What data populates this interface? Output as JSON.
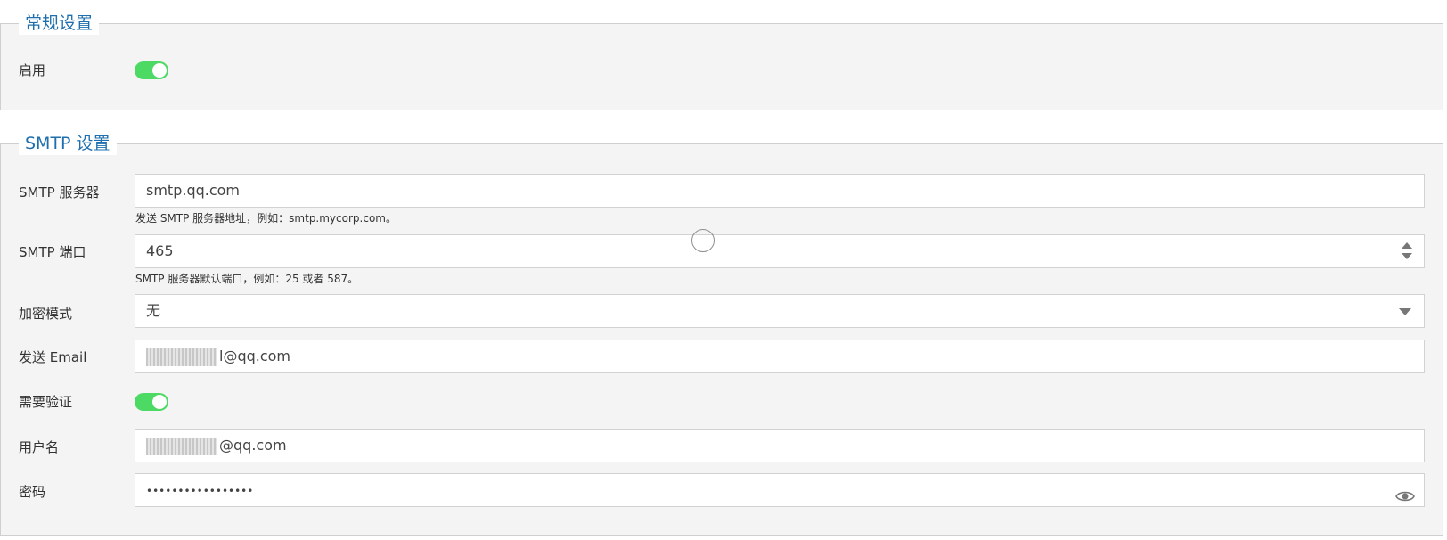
{
  "general": {
    "legend": "常规设置",
    "enabled_label": "启用",
    "enabled": true
  },
  "smtp": {
    "legend": "SMTP 设置",
    "server_label": "SMTP 服务器",
    "server_value": "smtp.qq.com",
    "server_hint": "发送 SMTP 服务器地址，例如：smtp.mycorp.com。",
    "port_label": "SMTP 端口",
    "port_value": "465",
    "port_hint": "SMTP 服务器默认端口，例如：25 或者 587。",
    "encryption_label": "加密模式",
    "encryption_value": "无",
    "from_email_label": "发送 Email",
    "from_email_visible": "l@qq.com",
    "auth_label": "需要验证",
    "auth_required": true,
    "username_label": "用户名",
    "username_visible": "@qq.com",
    "password_label": "密码",
    "password_mask": "•••••••••••••••••"
  },
  "icons": {
    "password_toggle": "eye-icon",
    "port_spinner": "spinner-arrows-icon",
    "encryption_dropdown": "chevron-down-icon"
  },
  "colors": {
    "legend_text": "#1f6fae",
    "toggle_on": "#4cd964",
    "panel_bg": "#f4f4f4"
  }
}
